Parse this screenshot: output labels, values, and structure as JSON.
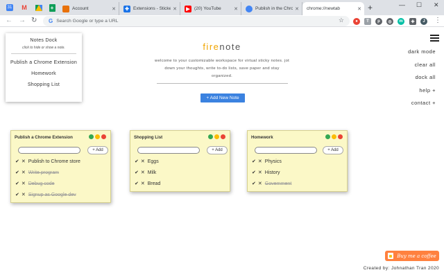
{
  "browser": {
    "tabs": [
      {
        "label": "",
        "icon": "calendar-icon",
        "color": "#4285f4",
        "pinned": true
      },
      {
        "label": "",
        "icon": "gmail-icon",
        "color": "#ea4335",
        "pinned": true
      },
      {
        "label": "",
        "icon": "drive-icon",
        "color": "#fbbc05",
        "pinned": true
      },
      {
        "label": "",
        "icon": "sheets-icon",
        "color": "#0f9d58",
        "pinned": true
      },
      {
        "label": "Account",
        "icon": "account-icon",
        "color": "#e8710a"
      },
      {
        "label": "Extensions - Sticke",
        "icon": "extension-puzzle-icon",
        "color": "#1a73e8"
      },
      {
        "label": "(20) YouTube",
        "icon": "youtube-icon",
        "color": "#ff0000"
      },
      {
        "label": "Publish in the Chro",
        "icon": "chrome-icon",
        "color": "#4285f4"
      },
      {
        "label": "chrome://newtab",
        "icon": "",
        "color": "#ffffff",
        "active": true
      }
    ],
    "omnibox_placeholder": "Search Google or type a URL"
  },
  "page": {
    "brand_fire": "fire",
    "brand_note": "note",
    "welcome": "welcome to your customizable workspace for virtual sticky notes. jot down your thoughts, write to-do lists, save paper and stay organized.",
    "add_note_label": "+ Add New Note",
    "side_menu": [
      "dark mode",
      "clear all",
      "dock all",
      "help +",
      "contact +"
    ],
    "dock": {
      "title": "Notes Dock",
      "subtitle": "click to hide or show a note.",
      "items": [
        "Publish a Chrome Extension",
        "Homework",
        "Shopping List"
      ]
    },
    "notes": [
      {
        "title": "Publish a Chrome Extension",
        "add_label": "+ Add",
        "items": [
          {
            "text": "Publish to Chrome store",
            "done": false
          },
          {
            "text": "Write program",
            "done": true
          },
          {
            "text": "Debug code",
            "done": true
          },
          {
            "text": "Signup as Google dev",
            "done": true
          }
        ]
      },
      {
        "title": "Shopping List",
        "add_label": "+ Add",
        "items": [
          {
            "text": "Eggs",
            "done": false
          },
          {
            "text": "Milk",
            "done": false
          },
          {
            "text": "Bread",
            "done": false
          }
        ]
      },
      {
        "title": "Homework",
        "add_label": "+ Add",
        "items": [
          {
            "text": "Physics",
            "done": false
          },
          {
            "text": "History",
            "done": false
          },
          {
            "text": "Government",
            "done": true
          }
        ]
      }
    ],
    "bmc_label": "Buy me a coffee",
    "credit": "Created by: Johnathan Tran 2020",
    "colors": {
      "accent": "#3b82e0",
      "note_bg": "#fbf8c7",
      "brand_fire": "#f0a500",
      "bmc": "#ff813f"
    }
  }
}
